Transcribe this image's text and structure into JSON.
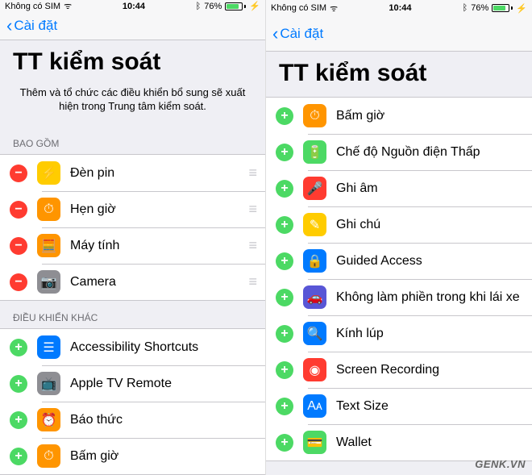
{
  "status": {
    "carrier": "Không có SIM",
    "time": "10:44",
    "battery_pct": "76%"
  },
  "nav": {
    "back_label": "Cài đặt"
  },
  "title": "TT kiểm soát",
  "desc": "Thêm và tổ chức các điều khiển bổ sung sẽ xuất hiện trong Trung tâm kiểm soát.",
  "sections": {
    "included_header": "BAO GỒM",
    "more_header": "ĐIỀU KHIỂN KHÁC"
  },
  "left": {
    "included": [
      {
        "label": "Đèn pin",
        "icon_bg": "#ffcc00",
        "glyph": "⚡"
      },
      {
        "label": "Hẹn giờ",
        "icon_bg": "#ff9500",
        "glyph": "⏱"
      },
      {
        "label": "Máy tính",
        "icon_bg": "#ff9500",
        "glyph": "🧮"
      },
      {
        "label": "Camera",
        "icon_bg": "#8e8e93",
        "glyph": "📷"
      }
    ],
    "more": [
      {
        "label": "Accessibility Shortcuts",
        "icon_bg": "#007aff",
        "glyph": "☰"
      },
      {
        "label": "Apple TV Remote",
        "icon_bg": "#8e8e93",
        "glyph": "📺"
      },
      {
        "label": "Báo thức",
        "icon_bg": "#ff9500",
        "glyph": "⏰"
      },
      {
        "label": "Bấm giờ",
        "icon_bg": "#ff9500",
        "glyph": "⏱"
      }
    ]
  },
  "right": {
    "more": [
      {
        "label": "Bấm giờ",
        "icon_bg": "#ff9500",
        "glyph": "⏱"
      },
      {
        "label": "Chế độ Nguồn điện Thấp",
        "icon_bg": "#4cd964",
        "glyph": "🔋"
      },
      {
        "label": "Ghi âm",
        "icon_bg": "#ff3b30",
        "glyph": "🎤"
      },
      {
        "label": "Ghi chú",
        "icon_bg": "#ffcc00",
        "glyph": "✎"
      },
      {
        "label": "Guided Access",
        "icon_bg": "#007aff",
        "glyph": "🔒"
      },
      {
        "label": "Không làm phiền trong khi lái xe",
        "icon_bg": "#5856d6",
        "glyph": "🚗"
      },
      {
        "label": "Kính lúp",
        "icon_bg": "#007aff",
        "glyph": "🔍"
      },
      {
        "label": "Screen Recording",
        "icon_bg": "#ff3b30",
        "glyph": "◉"
      },
      {
        "label": "Text Size",
        "icon_bg": "#007aff",
        "glyph": "Aᴀ"
      },
      {
        "label": "Wallet",
        "icon_bg": "#4cd964",
        "glyph": "💳"
      }
    ]
  },
  "watermark": "GENK.VN"
}
